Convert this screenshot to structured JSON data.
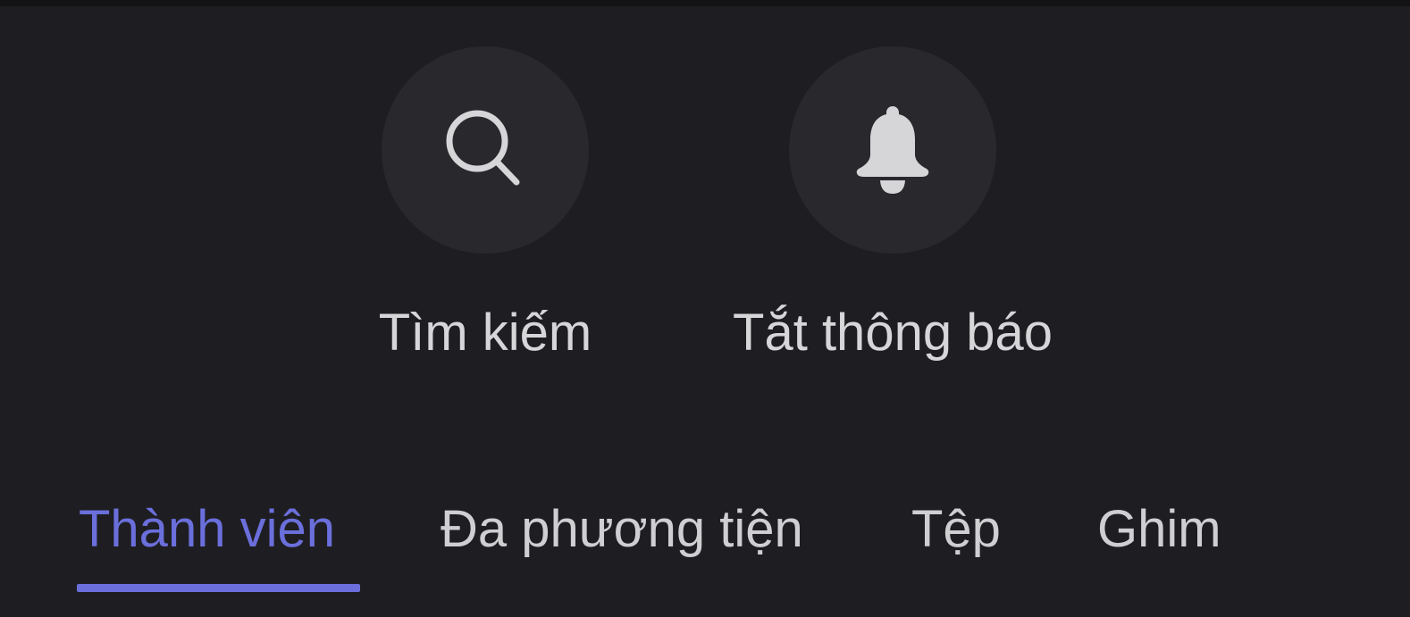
{
  "actions": {
    "search": {
      "label": "Tìm kiếm",
      "icon": "search-icon"
    },
    "mute": {
      "label": "Tắt thông báo",
      "icon": "bell-icon"
    }
  },
  "tabs": [
    {
      "label": "Thành viên",
      "active": true
    },
    {
      "label": "Đa phương tiện",
      "active": false
    },
    {
      "label": "Tệp",
      "active": false
    },
    {
      "label": "Ghim",
      "active": false
    }
  ],
  "colors": {
    "background": "#1e1e22",
    "accent": "#6b6fdc",
    "icon": "#d6d6d8",
    "circle": "#29292d"
  }
}
